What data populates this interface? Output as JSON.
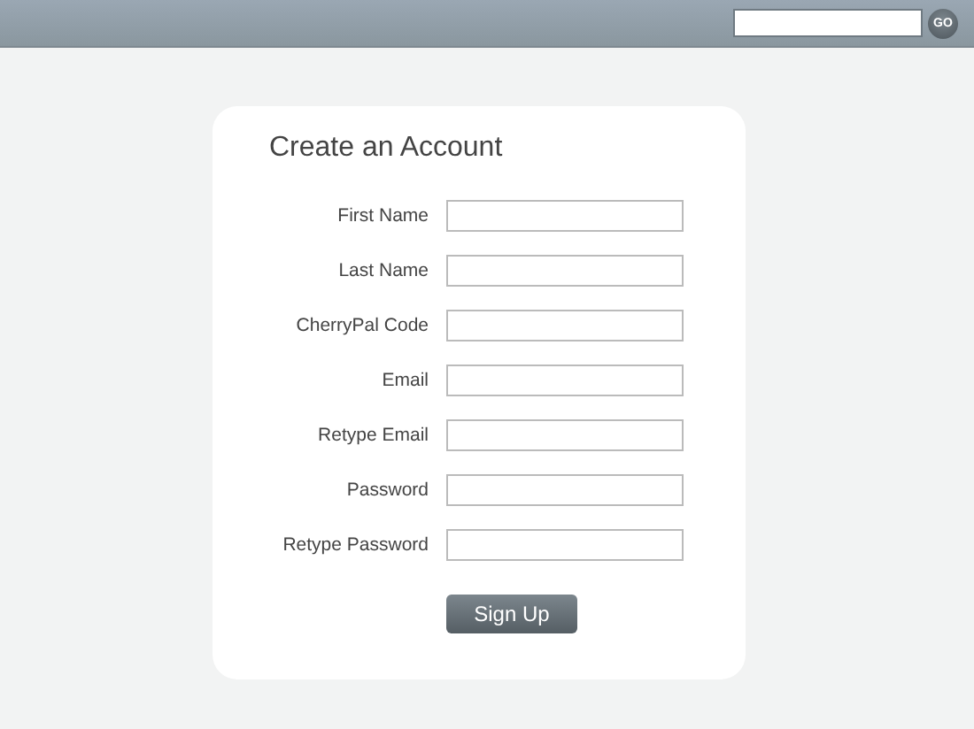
{
  "top_bar": {
    "go_button": "GO"
  },
  "form": {
    "title": "Create an Account",
    "fields": [
      {
        "label": "First Name"
      },
      {
        "label": "Last Name"
      },
      {
        "label": "CherryPal Code"
      },
      {
        "label": "Email"
      },
      {
        "label": "Retype Email"
      },
      {
        "label": "Password"
      },
      {
        "label": "Retype Password"
      }
    ],
    "submit": "Sign Up"
  }
}
